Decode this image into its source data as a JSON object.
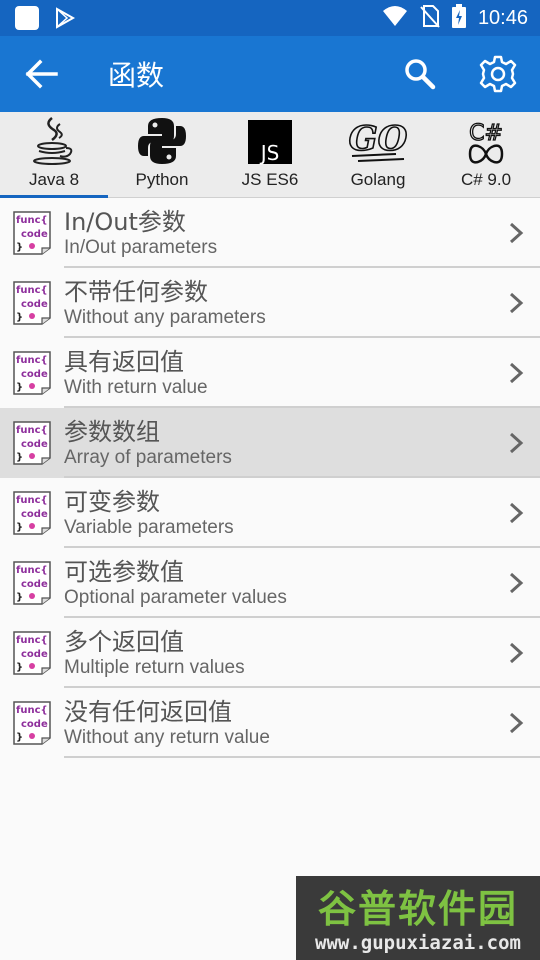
{
  "status_bar": {
    "time": "10:46",
    "icons": [
      "app-square-icon",
      "play-store-icon",
      "wifi-icon",
      "no-sim-icon",
      "battery-charging-icon"
    ]
  },
  "app_bar": {
    "title": "函数",
    "back_icon": "back-arrow-icon",
    "search_icon": "search-icon",
    "settings_icon": "gear-icon"
  },
  "tabs": [
    {
      "label": "Java 8",
      "icon": "java-icon",
      "active": true
    },
    {
      "label": "Python",
      "icon": "python-icon",
      "active": false
    },
    {
      "label": "JS ES6",
      "icon": "javascript-icon",
      "active": false
    },
    {
      "label": "Golang",
      "icon": "golang-icon",
      "active": false
    },
    {
      "label": "C# 9.0",
      "icon": "csharp-icon",
      "active": false
    }
  ],
  "items": [
    {
      "title_zh": "In/Out参数",
      "title_en": "In/Out parameters",
      "icon": "func-code-icon",
      "highlighted": false
    },
    {
      "title_zh": "不带任何参数",
      "title_en": "Without any parameters",
      "icon": "func-code-icon",
      "highlighted": false
    },
    {
      "title_zh": "具有返回值",
      "title_en": "With return value",
      "icon": "func-code-icon",
      "highlighted": false
    },
    {
      "title_zh": "参数数组",
      "title_en": "Array of parameters",
      "icon": "func-code-icon",
      "highlighted": true
    },
    {
      "title_zh": "可变参数",
      "title_en": "Variable parameters",
      "icon": "func-code-icon",
      "highlighted": false
    },
    {
      "title_zh": "可选参数值",
      "title_en": "Optional parameter values",
      "icon": "func-code-icon",
      "highlighted": false
    },
    {
      "title_zh": "多个返回值",
      "title_en": "Multiple return values",
      "icon": "func-code-icon",
      "highlighted": false
    },
    {
      "title_zh": "没有任何返回值",
      "title_en": "Without any return value",
      "icon": "func-code-icon",
      "highlighted": false
    }
  ],
  "func_icon_text": {
    "line1": "func{",
    "line2": "code",
    "line3": "}"
  },
  "watermark": {
    "text_zh": "谷普软件园",
    "text_url": "www.gupuxiazai.com"
  },
  "colors": {
    "status_bar": "#1565c0",
    "app_bar": "#1976d2",
    "tab_indicator": "#1565c0",
    "highlight_row": "#dedede",
    "watermark_green": "#7ec242"
  }
}
